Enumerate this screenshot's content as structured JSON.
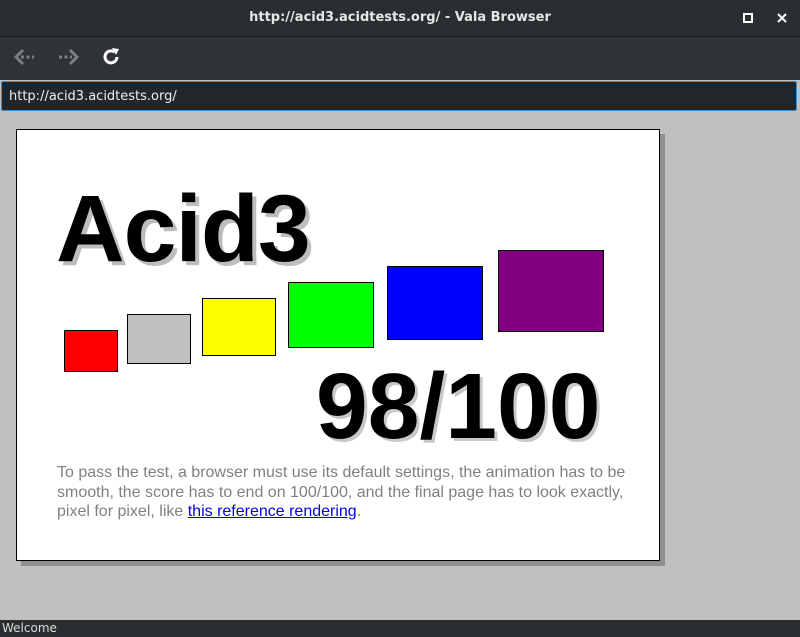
{
  "window": {
    "title": "http://acid3.acidtests.org/ - Vala Browser",
    "maximize_icon": "maximize-icon",
    "close_icon": "close-icon"
  },
  "toolbar": {
    "back_icon": "back-arrow-icon",
    "forward_icon": "forward-arrow-icon",
    "reload_icon": "reload-icon"
  },
  "address_bar": {
    "value": "http://acid3.acidtests.org/"
  },
  "page": {
    "heading": "Acid3",
    "score": "98/100",
    "boxes": [
      {
        "color": "#ff0000"
      },
      {
        "color": "#c0c0c0"
      },
      {
        "color": "#ffff00"
      },
      {
        "color": "#00ff00"
      },
      {
        "color": "#0000ff"
      },
      {
        "color": "#800080"
      }
    ],
    "note_text": "To pass the test, a browser must use its default settings, the animation has to be smooth, the score has to end on 100/100, and the final page has to look exactly, pixel for pixel, like ",
    "note_link": "this reference rendering",
    "note_end": "."
  },
  "status_bar": {
    "text": "Welcome"
  }
}
